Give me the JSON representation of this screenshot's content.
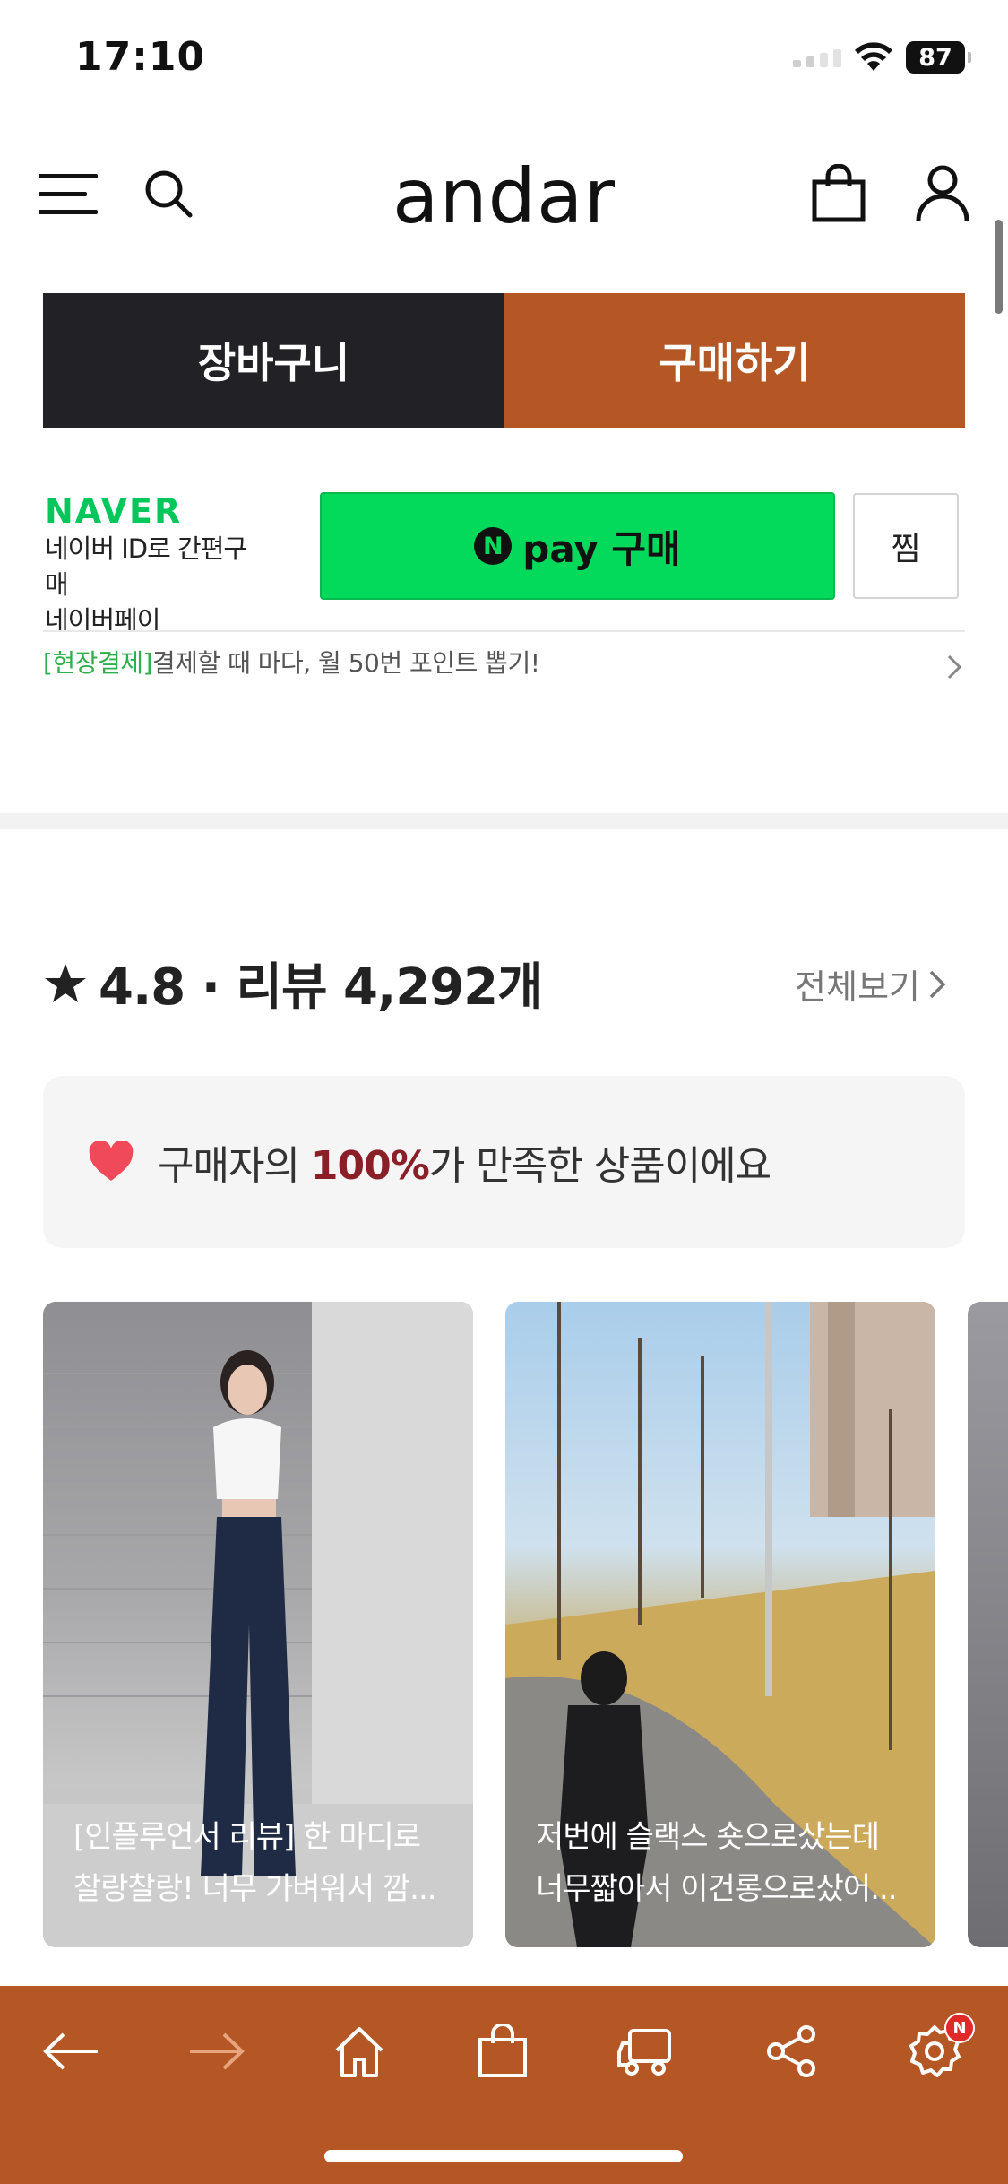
{
  "status_bar": {
    "time": "17:10",
    "battery": "87"
  },
  "header": {
    "logo": "andar",
    "menu_icon": "menu-icon",
    "search_icon": "search-icon",
    "bag_icon": "shopping-bag-icon",
    "user_icon": "user-icon"
  },
  "actions": {
    "cart_label": "장바구니",
    "buy_label": "구매하기"
  },
  "naver": {
    "logo": "NAVER",
    "line1": "네이버 ID로 간편구매",
    "line2": "네이버페이",
    "npay_n": "N",
    "npay_label": "pay 구매",
    "zzim_label": "찜"
  },
  "promo": {
    "tag": "[현장결제]",
    "text": "결제할 때 마다, 월 50번 포인트 뽑기!"
  },
  "reviews": {
    "rating_line": "4.8 · 리뷰 4,292개",
    "see_all": "전체보기",
    "satisfaction_prefix": "구매자의 ",
    "satisfaction_pct": "100%",
    "satisfaction_suffix": "가 만족한 상품이에요",
    "cards": [
      {
        "line1": "[인플루언서 리뷰] 한 마디로",
        "line2": "찰랑찰랑! 너무 가벼워서 깜..."
      },
      {
        "line1": "저번에 슬랙스 숏으로샀는데",
        "line2": "너무짧아서 이건롱으로샀어..."
      }
    ]
  },
  "bottom_nav": {
    "items": [
      "back-arrow-icon",
      "forward-arrow-icon",
      "home-icon",
      "shopping-bag-icon",
      "delivery-truck-icon",
      "share-icon",
      "settings-icon"
    ],
    "settings_badge": "N"
  },
  "colors": {
    "accent": "#b55725",
    "dark": "#222226",
    "naver_green": "#03c75a",
    "highlight": "#8b1f28"
  }
}
